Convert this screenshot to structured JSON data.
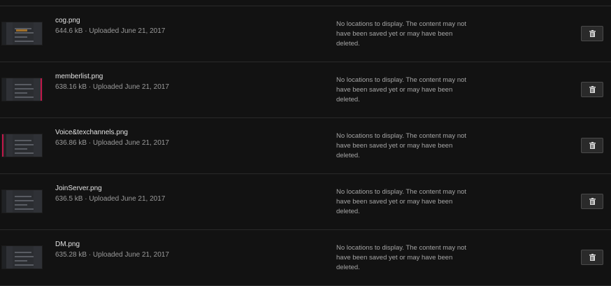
{
  "uploads": [
    {
      "name": "cog.png",
      "meta": "644.6 kB · Uploaded June 21, 2017",
      "locations": "No locations to display. The content may not have been saved yet or may have been deleted.",
      "thumb": "plain",
      "icon": "trash-icon"
    },
    {
      "name": "memberlist.png",
      "meta": "638.16 kB · Uploaded June 21, 2017",
      "locations": "No locations to display. The content may not have been saved yet or may have been deleted.",
      "thumb": "right-highlight",
      "icon": "trash-icon"
    },
    {
      "name": "Voice&texchannels.png",
      "meta": "636.86 kB · Uploaded June 21, 2017",
      "locations": "No locations to display. The content may not have been saved yet or may have been deleted.",
      "thumb": "left-highlight",
      "icon": "trash-icon"
    },
    {
      "name": "JoinServer.png",
      "meta": "636.5 kB · Uploaded June 21, 2017",
      "locations": "No locations to display. The content may not have been saved yet or may have been deleted.",
      "thumb": "plain",
      "icon": "trash-icon"
    },
    {
      "name": "DM.png",
      "meta": "635.28 kB · Uploaded June 21, 2017",
      "locations": "No locations to display. The content may not have been saved yet or may have been deleted.",
      "thumb": "plain",
      "icon": "trash-icon"
    }
  ],
  "colors": {
    "background": "#121212",
    "divider": "#2a2a2a",
    "name_text": "#e3e3e3",
    "meta_text": "#9a9a9a",
    "highlight": "#c2184a"
  }
}
